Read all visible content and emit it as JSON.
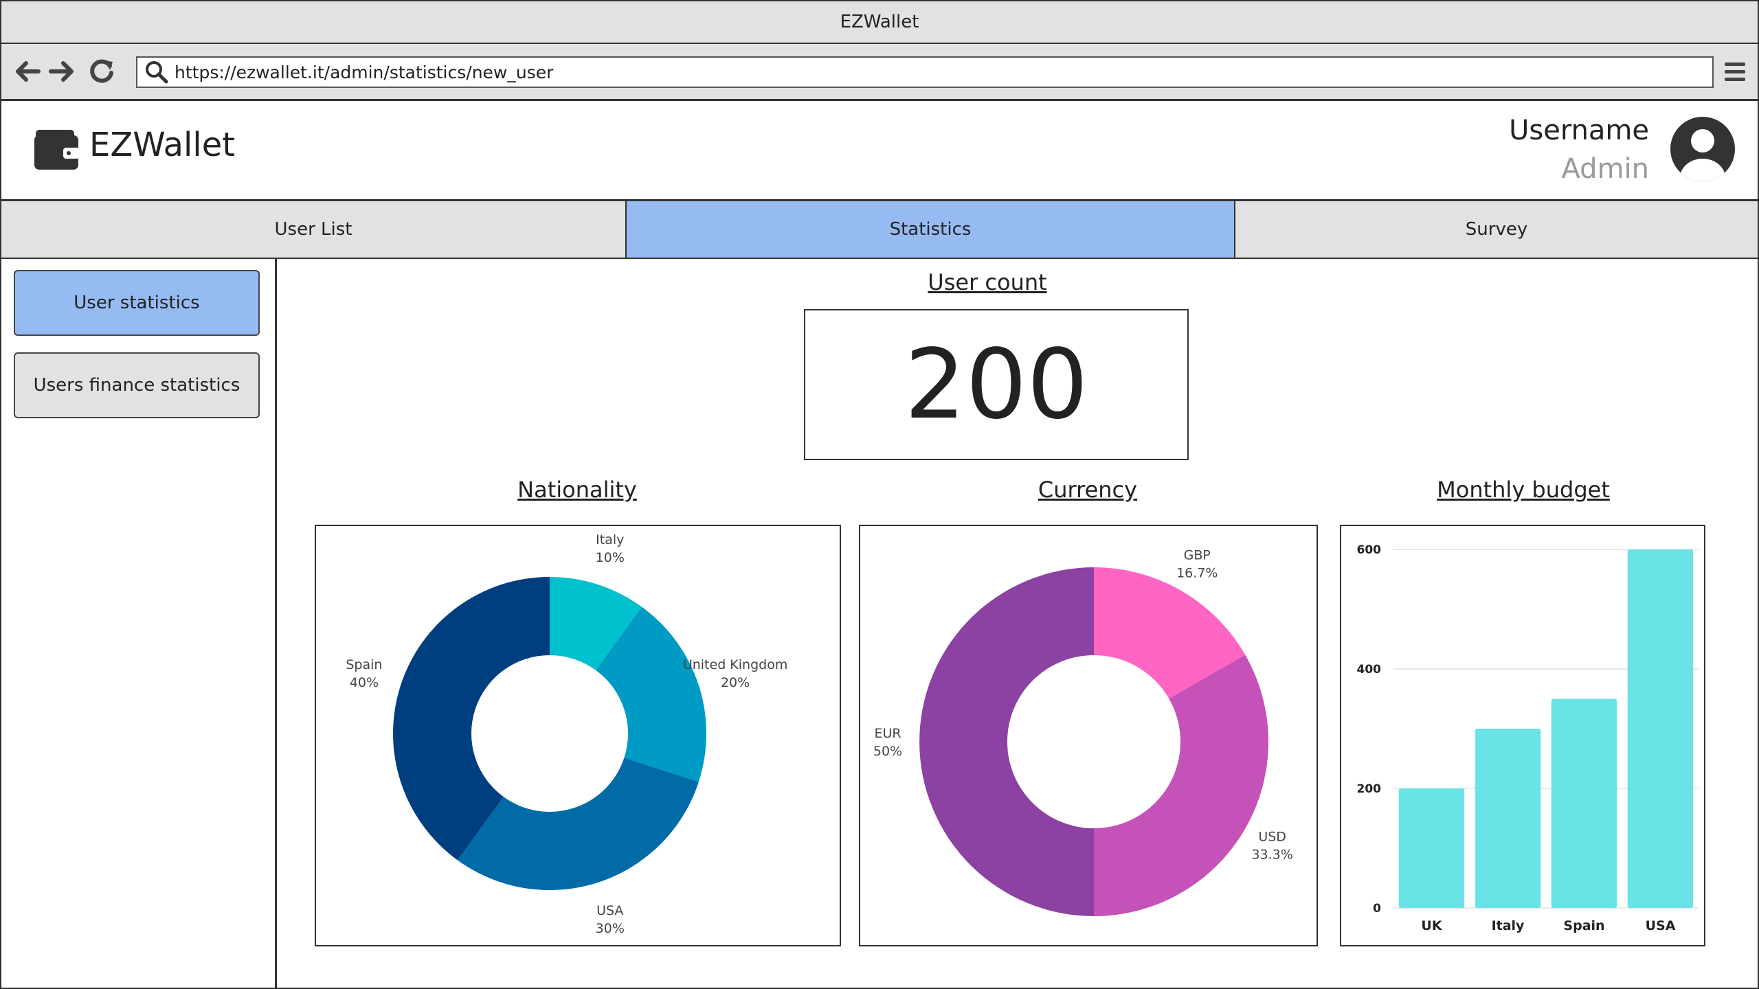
{
  "browser": {
    "window_title": "EZWallet",
    "url": "https://ezwallet.it/admin/statistics/new_user"
  },
  "app": {
    "name": "EZWallet",
    "user": {
      "name": "Username",
      "role": "Admin"
    }
  },
  "tabs": [
    {
      "label": "User List",
      "active": false
    },
    {
      "label": "Statistics",
      "active": true
    },
    {
      "label": "Survey",
      "active": false
    }
  ],
  "sidebar": {
    "items": [
      {
        "label": "User statistics",
        "active": true
      },
      {
        "label": "Users finance statistics",
        "active": false
      }
    ]
  },
  "main": {
    "user_count_title": "User count",
    "user_count_value": "200",
    "nationality_title": "Nationality",
    "currency_title": "Currency",
    "budget_title": "Monthly budget"
  },
  "colors": {
    "active_tab": "#95bbf2",
    "inactive": "#e2e2e2"
  },
  "chart_data": [
    {
      "type": "pie",
      "donut": true,
      "title": "Nationality",
      "slices": [
        {
          "name": "Italy",
          "label": "10%",
          "value": 10,
          "color": "#00c1cd"
        },
        {
          "name": "United Kingdom",
          "label": "20%",
          "value": 20,
          "color": "#009bc4"
        },
        {
          "name": "USA",
          "label": "30%",
          "value": 30,
          "color": "#006ba6"
        },
        {
          "name": "Spain",
          "label": "40%",
          "value": 40,
          "color": "#003f7f"
        }
      ]
    },
    {
      "type": "pie",
      "donut": true,
      "title": "Currency",
      "slices": [
        {
          "name": "GBP",
          "label": "16.7%",
          "value": 16.7,
          "color": "#ff66c4"
        },
        {
          "name": "USD",
          "label": "33.3%",
          "value": 33.3,
          "color": "#c452b8"
        },
        {
          "name": "EUR",
          "label": "50%",
          "value": 50,
          "color": "#8c42a2"
        }
      ]
    },
    {
      "type": "bar",
      "title": "Monthly budget",
      "categories": [
        "UK",
        "Italy",
        "Spain",
        "USA"
      ],
      "values": [
        200,
        300,
        350,
        600
      ],
      "yticks": [
        "0",
        "200",
        "400",
        "600"
      ],
      "ylim": [
        0,
        600
      ],
      "grid": true,
      "color": "#69e3e6"
    }
  ]
}
